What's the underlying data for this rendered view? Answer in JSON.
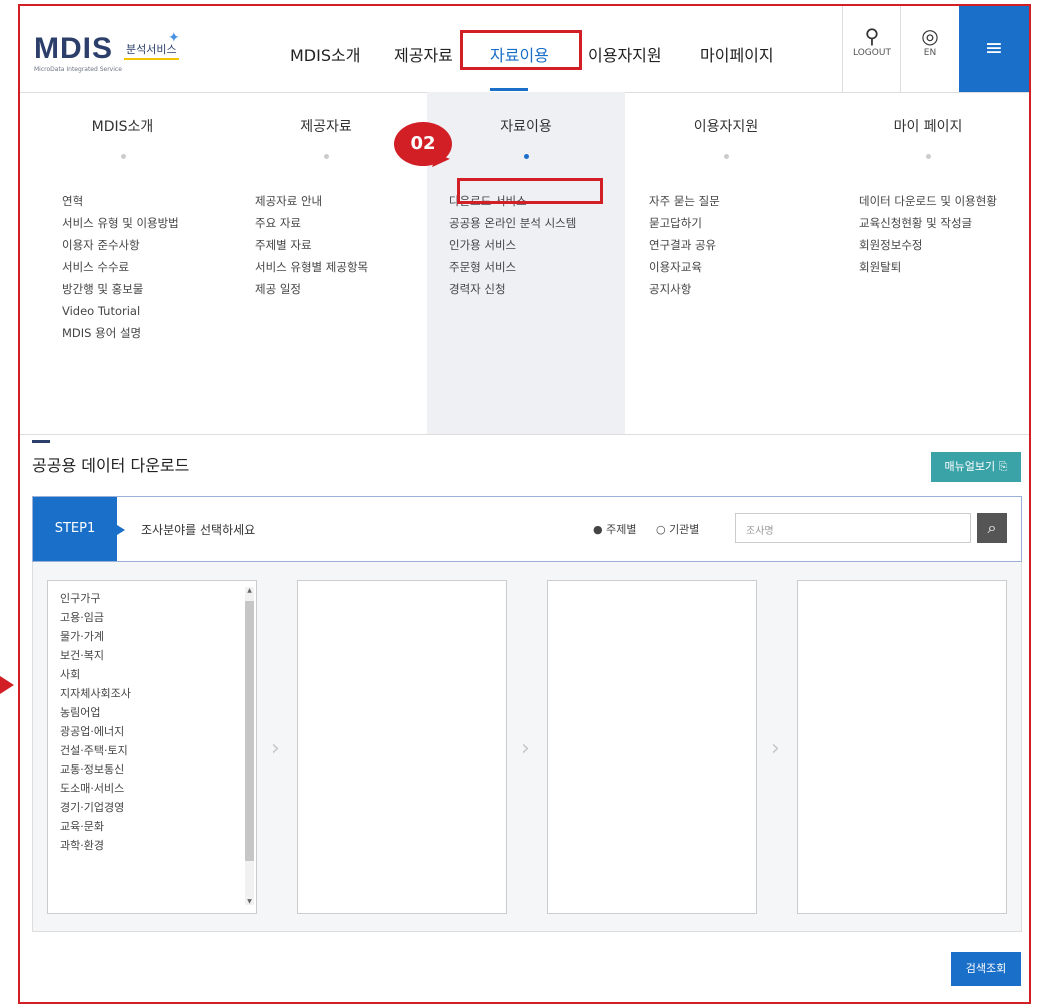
{
  "header": {
    "logo": "MDIS",
    "logo_sub": "MicroData Integrated Service",
    "badge": "분석서비스",
    "nav": [
      "MDIS소개",
      "제공자료",
      "자료이용",
      "이용자지원",
      "마이페이지"
    ],
    "logout_label": "LOGOUT",
    "lang_label": "EN",
    "menu_icon": "hamburger-icon"
  },
  "mega_menu": {
    "columns": [
      {
        "title": "MDIS소개",
        "items": [
          "연혁",
          "서비스 유형 및 이용방법",
          "이용자 준수사항",
          "서비스 수수료",
          "방간행 및 홍보물",
          "Video Tutorial",
          "MDIS 용어 설명"
        ]
      },
      {
        "title": "제공자료",
        "items": [
          "제공자료 안내",
          "주요 자료",
          "주제별 자료",
          "서비스 유형별 제공항목",
          "제공 일정"
        ]
      },
      {
        "title": "자료이용",
        "items": [
          "다운로드 서비스",
          "공공용 온라인 분석 시스템",
          "인가용 서비스",
          "주문형 서비스",
          "경력자 신청"
        ]
      },
      {
        "title": "이용자지원",
        "items": [
          "자주 묻는 질문",
          "묻고답하기",
          "연구결과 공유",
          "이용자교육",
          "공지사항"
        ]
      },
      {
        "title": "마이 페이지",
        "items": [
          "데이터 다운로드 및 이용현황",
          "교육신청현황 및 작성글",
          "회원정보수정",
          "회원탈퇴"
        ]
      }
    ],
    "step_badge": "02"
  },
  "section": {
    "title": "공공용 데이터 다운로드",
    "manual_button": "매뉴얼보기 ⎘"
  },
  "step": {
    "label": "STEP1",
    "text": "조사분야를 선택하세요",
    "radio_subject": "● 주제별",
    "radio_org": "○ 기관별",
    "search_placeholder": "조사명"
  },
  "categories": [
    "인구가구",
    "고용·임금",
    "물가·가계",
    "보건·복지",
    "사회",
    "지자체사회조사",
    "농림어업",
    "광공업·에너지",
    "건설·주택·토지",
    "교통·정보통신",
    "도소매·서비스",
    "경기·기업경영",
    "교육·문화",
    "과학·환경"
  ],
  "bottom_button": "검색조회",
  "colors": {
    "accent": "#1a6fc8",
    "highlight": "#d21f26",
    "teal": "#3aa3a8"
  }
}
